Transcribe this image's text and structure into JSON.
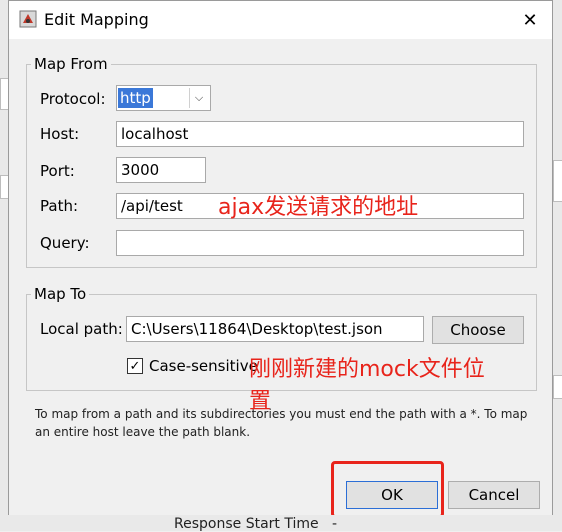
{
  "dialog": {
    "title": "Edit Mapping",
    "close_glyph": "✕"
  },
  "map_from": {
    "legend": "Map From",
    "protocol_label": "Protocol:",
    "protocol_value": "http",
    "host_label": "Host:",
    "host_value": "localhost",
    "port_label": "Port:",
    "port_value": "3000",
    "path_label": "Path:",
    "path_value": "/api/test",
    "query_label": "Query:",
    "query_value": ""
  },
  "map_to": {
    "legend": "Map To",
    "local_path_label": "Local path:",
    "local_path_value": "C:\\Users\\11864\\Desktop\\test.json",
    "choose_label": "Choose",
    "case_sensitive_label": "Case-sensitive",
    "case_sensitive_checked": true
  },
  "hint_text": "To map from a path and its subdirectories you must end the path with a *. To map an entire host leave the path blank.",
  "buttons": {
    "ok": "OK",
    "cancel": "Cancel"
  },
  "annotations": {
    "path_note": "ajax发送请求的地址",
    "file_note_line1": "刚刚新建的mock文件位",
    "file_note_line2": "置"
  },
  "background": {
    "response_label": "Response Start Time",
    "response_value": "-"
  },
  "colors": {
    "annotation_red": "#e8241b",
    "selection_blue": "#3b78d8",
    "default_button_border": "#2b6ed6"
  }
}
